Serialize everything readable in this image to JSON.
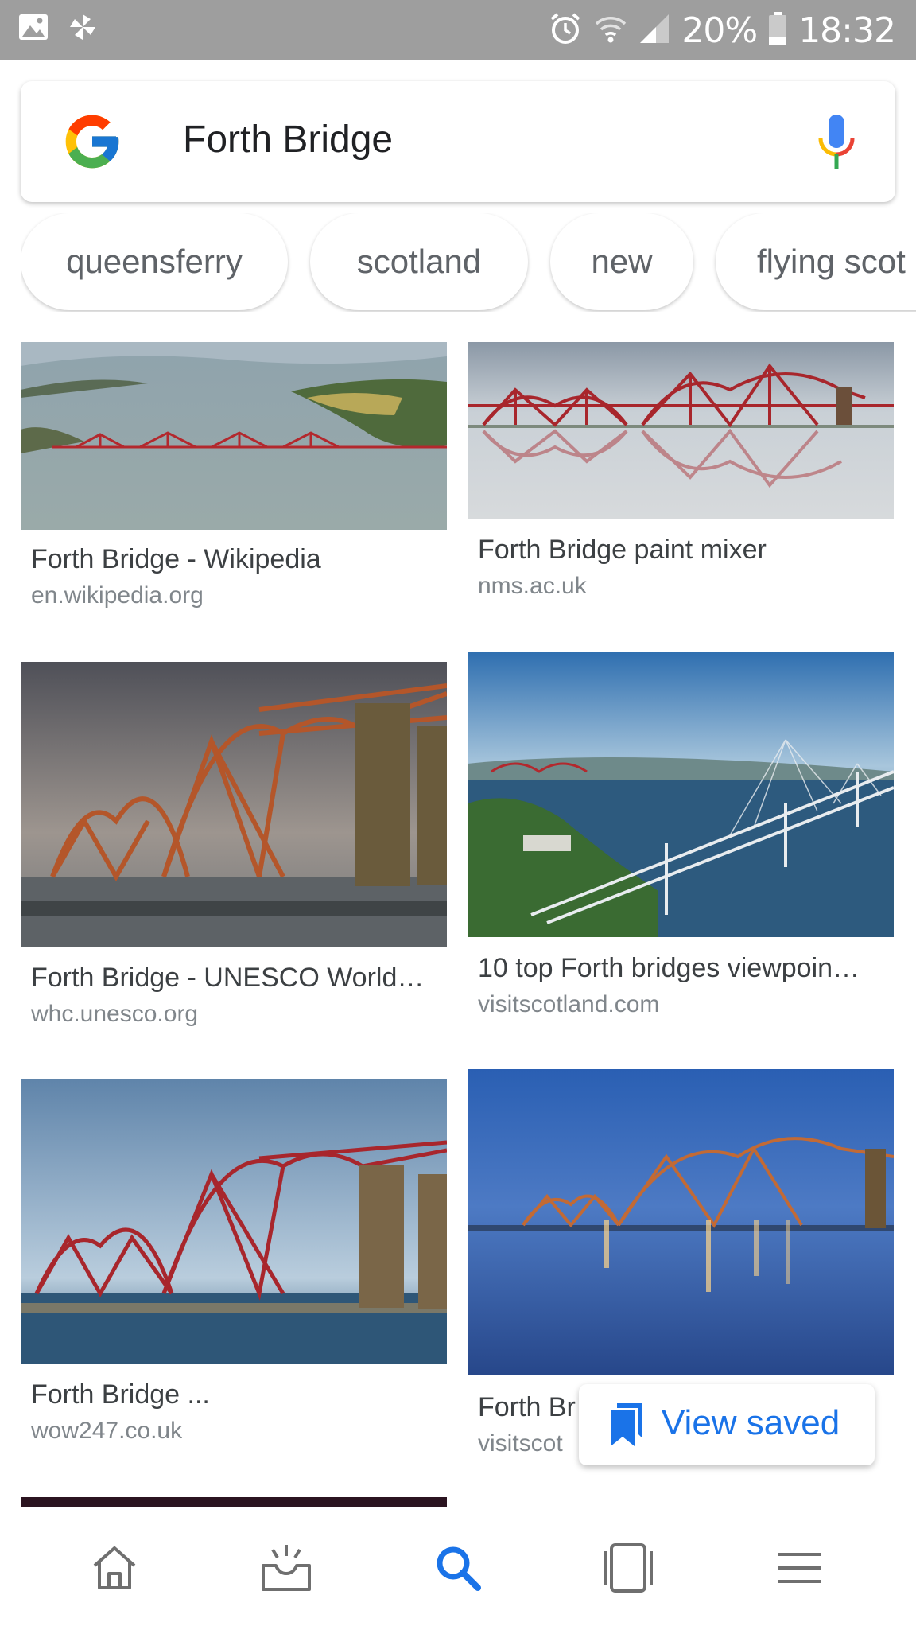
{
  "status_bar": {
    "battery_percent": "20%",
    "time": "18:32",
    "icons": [
      "image-icon",
      "pinwheel-icon",
      "alarm-icon",
      "wifi-icon",
      "signal-icon",
      "battery-icon"
    ]
  },
  "search": {
    "query": "Forth Bridge",
    "logo": "google-g-logo",
    "mic_icon": "mic-icon"
  },
  "chips": [
    "queensferry",
    "scotland",
    "new",
    "flying scot"
  ],
  "results": [
    {
      "title": "Forth Bridge - Wikipedia",
      "site": "en.wikipedia.org"
    },
    {
      "title": "Forth Bridge paint mixer",
      "site": "nms.ac.uk"
    },
    {
      "title": "Forth Bridge - UNESCO World…",
      "site": "whc.unesco.org"
    },
    {
      "title": "10 top Forth bridges viewpoin…",
      "site": "visitscotland.com"
    },
    {
      "title": "Forth Bridge ...",
      "site": "wow247.co.uk"
    },
    {
      "title": "Forth Br",
      "site": "visitscot"
    }
  ],
  "view_saved": {
    "label": "View saved",
    "icon": "bookmark-icon"
  },
  "bottom_nav": [
    "home-icon",
    "updates-icon",
    "search-icon",
    "tabs-icon",
    "menu-icon"
  ],
  "colors": {
    "accent": "#1a73e8",
    "status_bar": "#9e9e9e",
    "bridge_red": "#b3282d"
  }
}
